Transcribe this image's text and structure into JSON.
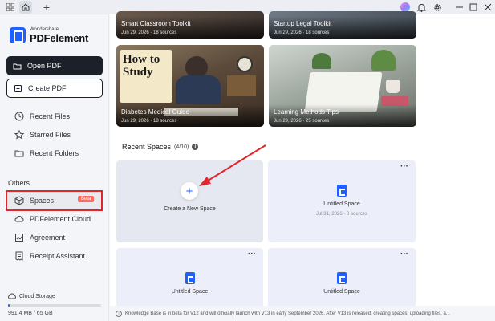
{
  "colors": {
    "accent": "#1f5eff",
    "highlight": "#e1262c",
    "dark_button": "#1c2029"
  },
  "titlebar": {
    "icons": [
      "grid-icon",
      "home-icon",
      "plus-icon",
      "avatar-icon",
      "bell-icon",
      "gear-icon",
      "minimize-icon",
      "maximize-icon",
      "close-icon"
    ]
  },
  "brand": {
    "sub": "Wondershare",
    "name": "PDFelement"
  },
  "sidebar": {
    "open_pdf": "Open PDF",
    "create_pdf": "Create PDF",
    "recent_files": "Recent Files",
    "starred_files": "Starred Files",
    "recent_folders": "Recent Folders",
    "others": "Others",
    "spaces": "Spaces",
    "beta": "Beta",
    "cloud": "PDFelement Cloud",
    "agreement": "Agreement",
    "receipt": "Receipt Assistant",
    "storage_label": "Cloud Storage",
    "storage_used": "991.4 MB / 65 GB",
    "storage_fraction": 0.015
  },
  "files": [
    {
      "title": "Smart Classroom Toolkit",
      "meta": "Jun 29, 2026 · 18 sources"
    },
    {
      "title": "Startup Legal Toolkit",
      "meta": "Jun 29, 2026 · 18 sources"
    },
    {
      "title": "Diabetes Medical Guide",
      "meta": "Jun 29, 2026 · 18 sources",
      "cover_text": "How to Study"
    },
    {
      "title": "Learning Methods  Tips",
      "meta": "Jun 29, 2026 · 25 sources"
    }
  ],
  "recent_spaces": {
    "title": "Recent Spaces",
    "count": "(4/10)",
    "info": "i",
    "create_label": "Create a New Space",
    "more": "···",
    "spaces": [
      {
        "name": "Untitled Space",
        "meta": "Jul 31, 2026 · 0 sources"
      },
      {
        "name": "Untitled Space",
        "meta": ""
      },
      {
        "name": "Untitled Space",
        "meta": ""
      }
    ]
  },
  "notice": "Knowledge Base is in beta for V12 and will officially launch with V13 in early September 2026. After V13 is released, creating spaces, uploading files, a..."
}
